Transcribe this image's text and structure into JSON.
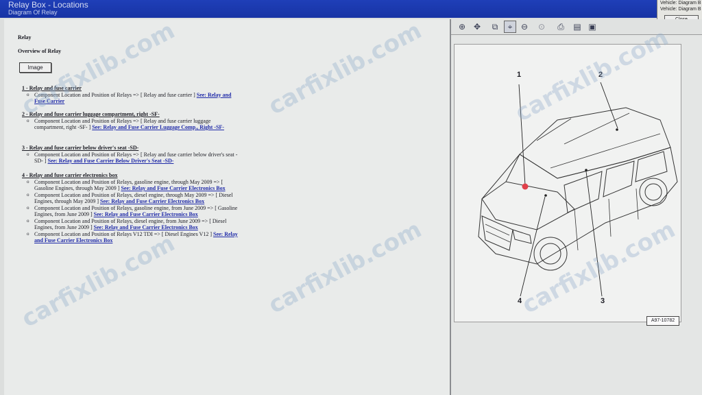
{
  "window": {
    "title": "Relay Box - Locations",
    "subtitle": "Diagram Of Relay"
  },
  "vehicle_popup": {
    "row1": "Vehicle: Diagram B",
    "row2": "Vehicle: Diagram B",
    "close_label": "Close"
  },
  "document": {
    "heading": "Relay",
    "subheading": "Overview of Relay",
    "image_button": "Image",
    "sections": [
      {
        "title": "1 - Relay and fuse carrier",
        "items": [
          {
            "text": "Component Location and Position of Relays => [ Relay and fuse carrier ] ",
            "link": "See: Relay and Fuse Carrier"
          }
        ]
      },
      {
        "title": "2 - Relay and fuse carrier luggage compartment, right -SF-",
        "items": [
          {
            "text": "Component Location and Position of Relays => [ Relay and fuse carrier luggage compartment, right -SF- ] ",
            "link": "See: Relay and Fuse Carrier Luggage Comp., Right -SF-"
          }
        ]
      },
      {
        "title": "3 - Relay and fuse carrier below driver's seat -SD-",
        "items": [
          {
            "text": "Component Location and Position of Relays => [ Relay and fuse carrier below driver's seat -SD- ] ",
            "link": "See: Relay and Fuse Carrier Below Driver's Seat -SD-"
          }
        ]
      },
      {
        "title": "4 - Relay and fuse carrier electronics box",
        "items": [
          {
            "text": "Component Location and Position of Relays, gasoline engine, through May 2009 => [ Gasoline Engines, through May 2009 ] ",
            "link": "See: Relay and Fuse Carrier Electronics Box"
          },
          {
            "text": "Component Location and Position of Relays, diesel engine, through May 2009 => [ Diesel Engines, through May 2009 ] ",
            "link": "See: Relay and Fuse Carrier Electronics Box"
          },
          {
            "text": "Component Location and Position of Relays, gasoline engine, from June 2009 => [ Gasoline Engines, from June 2009 ] ",
            "link": "See: Relay and Fuse Carrier Electronics Box"
          },
          {
            "text": "Component Location and Position of Relays, diesel engine, from June 2009 => [ Diesel Engines, from June 2009 ] ",
            "link": "See: Relay and Fuse Carrier Electronics Box"
          },
          {
            "text": "Component Location and Position of Relays V12 TDI => [ Diesel Engines V12 ] ",
            "link": "See: Relay and Fuse Carrier Electronics Box"
          }
        ]
      }
    ]
  },
  "toolbar": {
    "buttons": [
      "zoom-in-icon",
      "pan-icon",
      "zoom-window-icon",
      "zoom-fit-icon",
      "zoom-out-icon",
      "zoom-reset-icon",
      "print-icon",
      "copy-icon",
      "save-icon"
    ]
  },
  "figure": {
    "callouts": [
      "1",
      "2",
      "3",
      "4"
    ],
    "figure_id": "A97-10782"
  },
  "watermark": "carfixlib.com",
  "colors": {
    "title_bar": "#1f3fb8",
    "link": "#1f2aa8",
    "marker": "#e0404a"
  }
}
